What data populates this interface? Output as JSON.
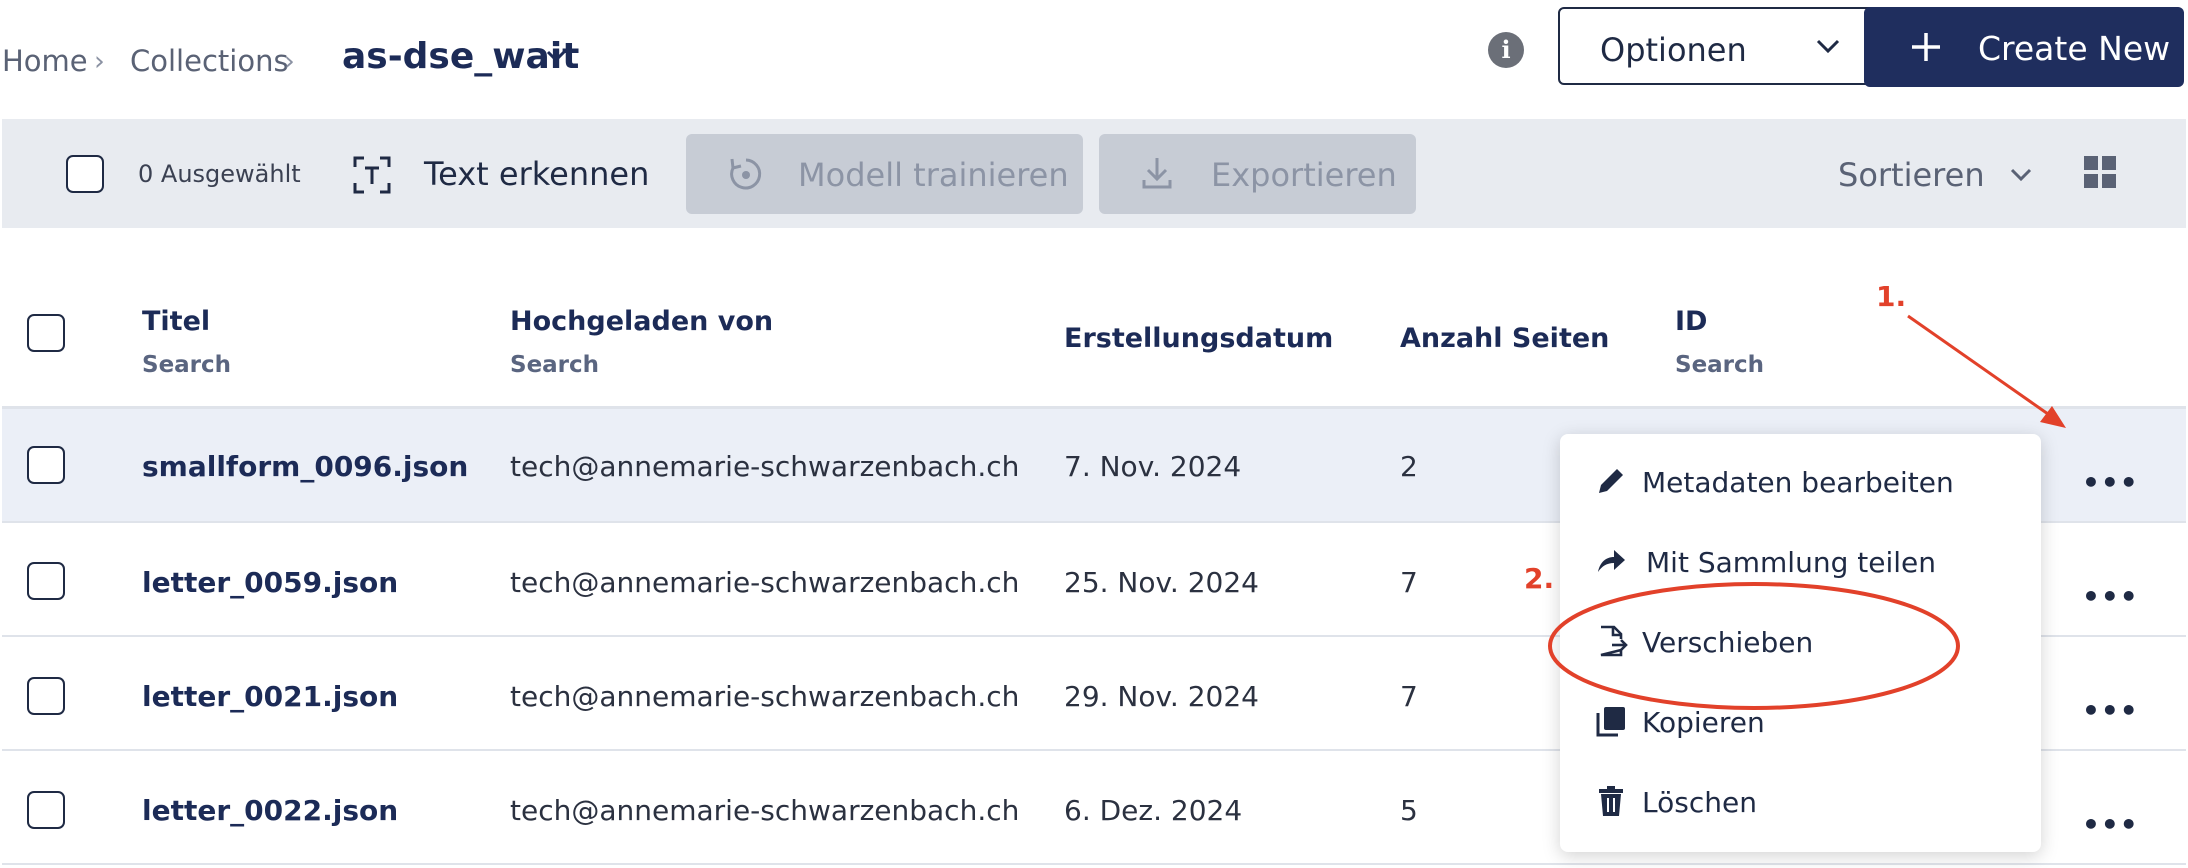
{
  "breadcrumb": {
    "home": "Home",
    "collections": "Collections",
    "current": "as-dse_wait"
  },
  "header": {
    "options_label": "Optionen",
    "create_label": "Create New"
  },
  "toolbar": {
    "selected_count": "0 Ausgewählt",
    "recognize_text": "Text erkennen",
    "train_model": "Modell trainieren",
    "export": "Exportieren",
    "sort": "Sortieren"
  },
  "table": {
    "columns": {
      "title": "Titel",
      "uploaded_by": "Hochgeladen von",
      "created": "Erstellungsdatum",
      "pages": "Anzahl Seiten",
      "id": "ID",
      "search": "Search"
    },
    "rows": [
      {
        "title": "smallform_0096.json",
        "uploader": "tech@annemarie-schwarzenbach.ch",
        "date": "7. Nov. 2024",
        "pages": "2"
      },
      {
        "title": "letter_0059.json",
        "uploader": "tech@annemarie-schwarzenbach.ch",
        "date": "25. Nov. 2024",
        "pages": "7"
      },
      {
        "title": "letter_0021.json",
        "uploader": "tech@annemarie-schwarzenbach.ch",
        "date": "29. Nov. 2024",
        "pages": "7"
      },
      {
        "title": "letter_0022.json",
        "uploader": "tech@annemarie-schwarzenbach.ch",
        "date": "6. Dez. 2024",
        "pages": "5"
      }
    ],
    "row_menu_label": "•••"
  },
  "context_menu": {
    "items": [
      "Metadaten bearbeiten",
      "Mit Sammlung teilen",
      "Verschieben",
      "Kopieren",
      "Löschen"
    ]
  },
  "annotations": {
    "step1": "1.",
    "step2": "2."
  },
  "colors": {
    "primary": "#1f2e5e",
    "toolbar_bg": "#e8ebf0",
    "annotation": "#e2412a",
    "row_highlight": "#ebeff7"
  }
}
